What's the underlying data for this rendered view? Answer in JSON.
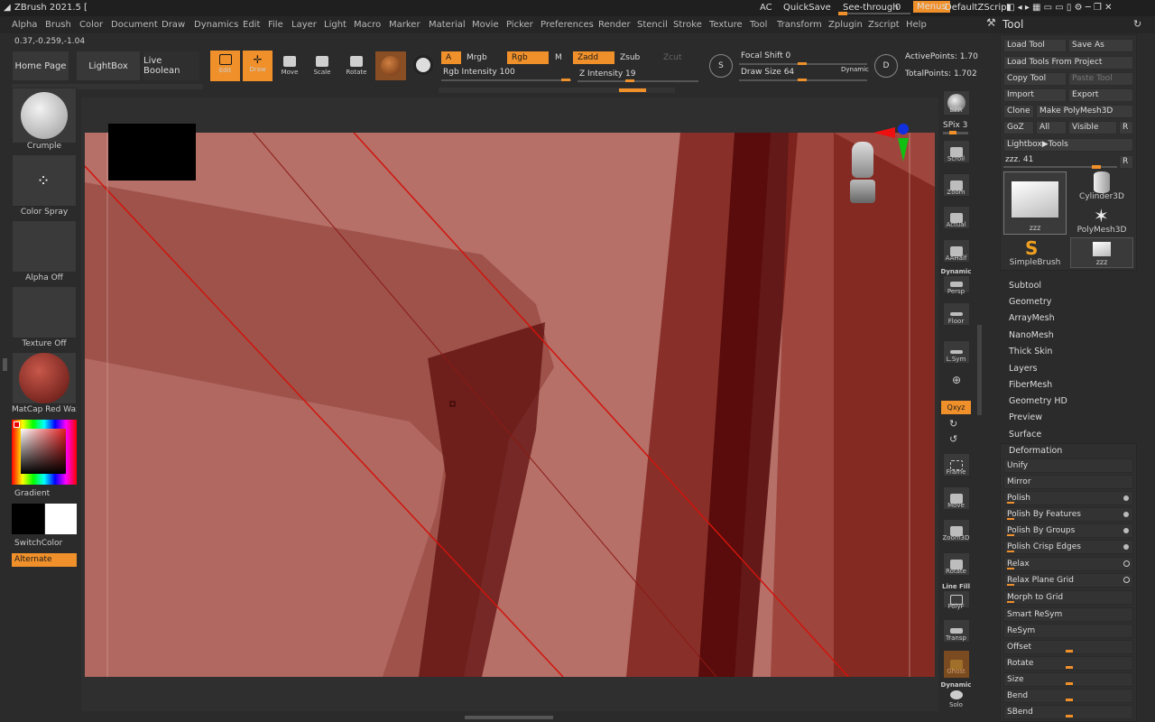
{
  "app": {
    "title": "ZBrush 2021.5 ["
  },
  "titlebar": {
    "ac": "AC",
    "quicksave": "QuickSave",
    "seethrough_label": "See-through",
    "seethrough_value": "0",
    "menus": "Menus",
    "default_zscript": "DefaultZScript"
  },
  "menubar": [
    "Alpha",
    "Brush",
    "Color",
    "Document",
    "Draw",
    "Dynamics",
    "Edit",
    "File",
    "Layer",
    "Light",
    "Macro",
    "Marker",
    "Material",
    "Movie",
    "Picker",
    "Preferences",
    "Render",
    "Stencil",
    "Stroke",
    "Texture",
    "Tool",
    "Transform",
    "Zplugin",
    "Zscript",
    "Help"
  ],
  "coords": "0.37,-0.259,-1.04",
  "toolbar": {
    "home_page": "Home Page",
    "lightbox": "LightBox",
    "live_boolean": "Live Boolean",
    "edit": "Edit",
    "draw": "Draw",
    "move": "Move",
    "scale": "Scale",
    "rotate": "Rotate",
    "a": "A",
    "mrgb": "Mrgb",
    "rgb": "Rgb",
    "m": "M",
    "zadd": "Zadd",
    "zsub": "Zsub",
    "zcut": "Zcut",
    "rgb_intensity": "Rgb Intensity 100",
    "z_intensity": "Z Intensity 19",
    "focal_shift": "Focal Shift 0",
    "draw_size": "Draw Size 64",
    "dynamic": "Dynamic",
    "active_points": "ActivePoints: 1.70",
    "total_points": "TotalPoints: 1.702"
  },
  "leftpanel": {
    "brush": "Crumple",
    "stroke": "Color Spray",
    "alpha": "Alpha Off",
    "texture": "Texture Off",
    "material": "MatCap Red Wax",
    "gradient": "Gradient",
    "switchcolor": "SwitchColor",
    "alternate": "Alternate"
  },
  "rightdock": {
    "bpr": "BPR",
    "spix": "SPix 3",
    "scroll": "Scroll",
    "zoom": "Zoom",
    "actual": "Actual",
    "aahalf": "AAHalf",
    "dynamic": "Dynamic",
    "persp": "Persp",
    "floor": "Floor",
    "lsym": "L.Sym",
    "xyz": "Qxyz",
    "frame": "Frame",
    "move": "Move",
    "zoom3d": "Zoom3D",
    "rotate": "Rotate",
    "linefill": "Line Fill",
    "polyf": "PolyF",
    "transp": "Transp",
    "ghost": "Ghost",
    "solo_dyn": "Dynamic",
    "solo": "Solo"
  },
  "tool": {
    "title": "Tool",
    "load_tool": "Load Tool",
    "save_as": "Save As",
    "load_from_project": "Load Tools From Project",
    "copy_tool": "Copy Tool",
    "paste_tool": "Paste Tool",
    "import": "Import",
    "export": "Export",
    "clone": "Clone",
    "make_polymesh": "Make PolyMesh3D",
    "goz": "GoZ",
    "all": "All",
    "visible": "Visible",
    "r": "R",
    "lightbox_tools": "Lightbox▶Tools",
    "zzz": "zzz. 41",
    "thumbs": {
      "zzz_main": "zzz",
      "cylinder": "Cylinder3D",
      "polymesh": "PolyMesh3D",
      "simplebrush": "SimpleBrush",
      "zzz_small": "zzz"
    },
    "sections": [
      "Subtool",
      "Geometry",
      "ArrayMesh",
      "NanoMesh",
      "Thick Skin",
      "Layers",
      "FiberMesh",
      "Geometry HD",
      "Preview",
      "Surface"
    ],
    "deformation": "Deformation",
    "deform_items": [
      "Unify",
      "Mirror",
      "Polish",
      "Polish By Features",
      "Polish By Groups",
      "Polish Crisp Edges",
      "Relax",
      "Relax Plane Grid",
      "Morph to Grid",
      "Smart ReSym",
      "ReSym",
      "Offset",
      "Rotate",
      "Size",
      "Bend",
      "SBend"
    ]
  },
  "colors": {
    "accent": "#f0902a",
    "bg": "#2b2b2b",
    "viewport": "#b8706a"
  }
}
